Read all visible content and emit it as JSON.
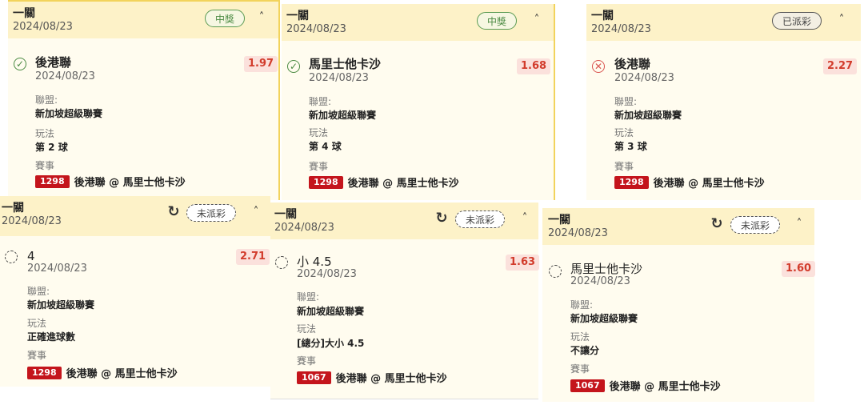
{
  "cards": [
    {
      "type": "一關",
      "date": "2024/08/23",
      "status": "中獎",
      "selection": "後港聯",
      "sel_date": "2024/08/23",
      "odds": "1.97",
      "league_label": "聯盟:",
      "league": "新加坡超級聯賽",
      "play_label": "玩法",
      "play": "第 2 球",
      "event_label": "賽事",
      "event_code": "1298",
      "event_match": "後港聯 @ 馬里士他卡沙"
    },
    {
      "type": "一關",
      "date": "2024/08/23",
      "status": "中獎",
      "selection": "馬里士他卡沙",
      "sel_date": "2024/08/23",
      "odds": "1.68",
      "league_label": "聯盟:",
      "league": "新加坡超級聯賽",
      "play_label": "玩法",
      "play": "第 4 球",
      "event_label": "賽事",
      "event_code": "1298",
      "event_match": "後港聯 @ 馬里士他卡沙"
    },
    {
      "type": "一關",
      "date": "2024/08/23",
      "status": "已派彩",
      "selection": "後港聯",
      "sel_date": "2024/08/23",
      "odds": "2.27",
      "league_label": "聯盟:",
      "league": "新加坡超級聯賽",
      "play_label": "玩法",
      "play": "第 3 球",
      "event_label": "賽事",
      "event_code": "1298",
      "event_match": "後港聯 @ 馬里士他卡沙"
    },
    {
      "type": "一關",
      "date": "2024/08/23",
      "status": "未派彩",
      "selection": "4",
      "sel_date": "2024/08/23",
      "odds": "2.71",
      "league_label": "聯盟:",
      "league": "新加坡超級聯賽",
      "play_label": "玩法",
      "play": "正確進球數",
      "event_label": "賽事",
      "event_code": "1298",
      "event_match": "後港聯 @ 馬里士他卡沙"
    },
    {
      "type": "一關",
      "date": "2024/08/23",
      "status": "未派彩",
      "selection": "小 4.5",
      "sel_date": "2024/08/23",
      "odds": "1.63",
      "league_label": "聯盟:",
      "league": "新加坡超級聯賽",
      "play_label": "玩法",
      "play": "[總分]大小 4.5",
      "event_label": "賽事",
      "event_code": "1067",
      "event_match": "後港聯 @ 馬里士他卡沙"
    },
    {
      "type": "一關",
      "date": "2024/08/23",
      "status": "未派彩",
      "selection": "馬里士他卡沙",
      "sel_date": "2024/08/23",
      "odds": "1.60",
      "league_label": "聯盟:",
      "league": "新加坡超級聯賽",
      "play_label": "玩法",
      "play": "不讓分",
      "event_label": "賽事",
      "event_code": "1067",
      "event_match": "後港聯 @ 馬里士他卡沙"
    }
  ],
  "icons": {
    "expand": "chevron-up-icon",
    "refresh": "refresh-icon",
    "win": "check-circle-icon",
    "lose": "x-circle-icon",
    "pending": "dashed-circle-icon"
  },
  "colors": {
    "header_bg": "#fdf2c8",
    "card_bg": "#fffcef",
    "odds_bg": "#fbe1dc",
    "odds_text": "#d23c2c",
    "code_bg": "#c4151c",
    "win": "#4a8a42",
    "lose": "#d9534f"
  }
}
